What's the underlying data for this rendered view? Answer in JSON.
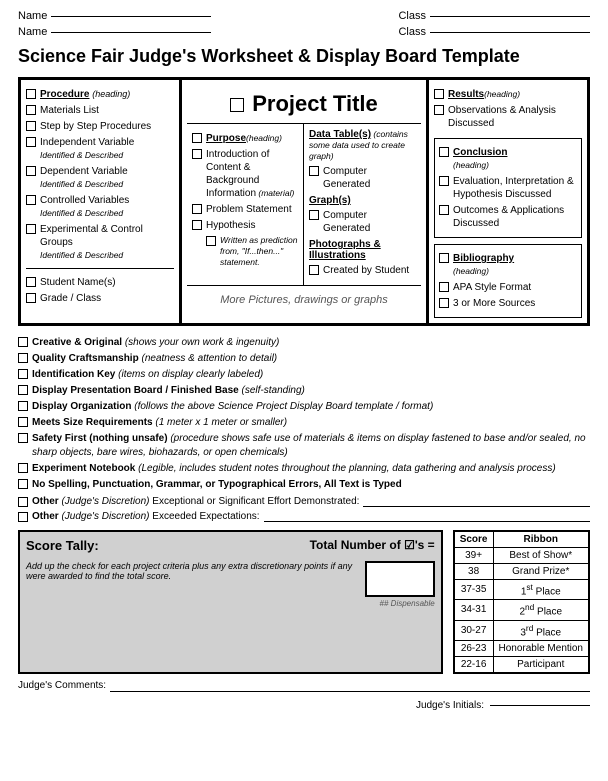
{
  "header": {
    "name_label": "Name",
    "class_label": "Class",
    "title": "Science Fair Judge's Worksheet & Display Board Template"
  },
  "left_col": {
    "procedure_heading": "Procedure",
    "procedure_sub": "(heading)",
    "items": [
      "Materials List",
      "Step by Step Procedures",
      "Independent Variable",
      "Dependent Variable",
      "Controlled Variables",
      "Experimental & Control Groups"
    ],
    "items_subs": [
      "",
      "",
      "Identified & Described",
      "Identified & Described",
      "Identified & Described",
      "Identified & Described"
    ],
    "bottom_items": [
      "Student Name(s)",
      "Grade / Class"
    ]
  },
  "center_col": {
    "title": "Project Title",
    "purpose_heading": "Purpose",
    "purpose_sub": "(heading)",
    "purpose_items": [
      "Introduction of Content & Background Information",
      "Problem Statement",
      "Hypothesis"
    ],
    "purpose_items_subs": [
      "(material)",
      "",
      ""
    ],
    "hypothesis_sub": "Written as prediction from, \"If...then...\" statement.",
    "data_heading": "Data Table(s)",
    "data_sub": "(contains some data used to create graph)",
    "data_items": [
      "Computer Generated"
    ],
    "graphs_heading": "Graph(s)",
    "graphs_items": [
      "Computer Generated"
    ],
    "photos_heading": "Photographs & Illustrations",
    "photos_items": [
      "Created by Student"
    ],
    "bottom_text": "More Pictures, drawings or graphs"
  },
  "right_col": {
    "results_heading": "Results",
    "results_sub": "(heading)",
    "results_items": [
      "Observations & Analysis Discussed"
    ],
    "conclusion_heading": "Conclusion",
    "conclusion_sub": "(heading)",
    "conclusion_items": [
      "Evaluation, Interpretation & Hypothesis Discussed",
      "Outcomes & Applications Discussed"
    ],
    "bibliography_heading": "Bibliography",
    "bibliography_sub": "(heading)",
    "bibliography_items": [
      "APA Style Format",
      "3 or More Sources"
    ]
  },
  "checklist": {
    "items": [
      {
        "label": "Creative & Original",
        "sub": "(shows your own work & ingenuity)"
      },
      {
        "label": "Quality Craftsmanship",
        "sub": "(neatness & attention to detail)"
      },
      {
        "label": "Identification Key",
        "sub": "(items on display clearly labeled)"
      },
      {
        "label": "Display Presentation Board / Finished Base",
        "sub": "(self-standing)"
      },
      {
        "label": "Display Organization",
        "sub": "(follows the above Science Project Display Board template / format)"
      },
      {
        "label": "Meets Size Requirements",
        "sub": "(1 meter x 1 meter or smaller)"
      },
      {
        "label": "Safety First (nothing unsafe)",
        "sub": "(procedure shows safe use of materials & items on display fastened to base and/or sealed, no sharp objects, bare wires, biohazards, or open chemicals)"
      },
      {
        "label": "Experiment Notebook",
        "sub": "(Legible, includes student notes throughout the planning, data gathering and analysis process)"
      },
      {
        "label": "No Spelling, Punctuation, Grammar, or Typographical Errors, All Text is Typed",
        "sub": ""
      }
    ],
    "other1_label": "Other",
    "other1_sub": "(Judge's Discretion)",
    "other1_text": "Exceptional or Significant Effort Demonstrated:",
    "other2_label": "Other",
    "other2_sub": "(Judge's Discretion)",
    "other2_text": "Exceeded Expectations:"
  },
  "score_tally": {
    "title": "Score Tally:",
    "desc": "Add up the check for each project criteria plus any extra discretionary points if any were awarded to find the total score.",
    "total_label": "Total Number of",
    "check_symbol": "✓",
    "apostrophe": "'s =",
    "dispensable": "## Dispensable"
  },
  "ribbon_table": {
    "headers": [
      "Score",
      "Ribbon"
    ],
    "rows": [
      [
        "39+",
        "Best of Show*"
      ],
      [
        "38",
        "Grand Prize*"
      ],
      [
        "37-35",
        "1st Place"
      ],
      [
        "34-31",
        "2nd Place"
      ],
      [
        "30-27",
        "3rd Place"
      ],
      [
        "26-23",
        "Honorable Mention"
      ],
      [
        "22-16",
        "Participant"
      ]
    ]
  },
  "judges_comments_label": "Judge's Comments:",
  "judges_initials_label": "Judge's Initials:"
}
